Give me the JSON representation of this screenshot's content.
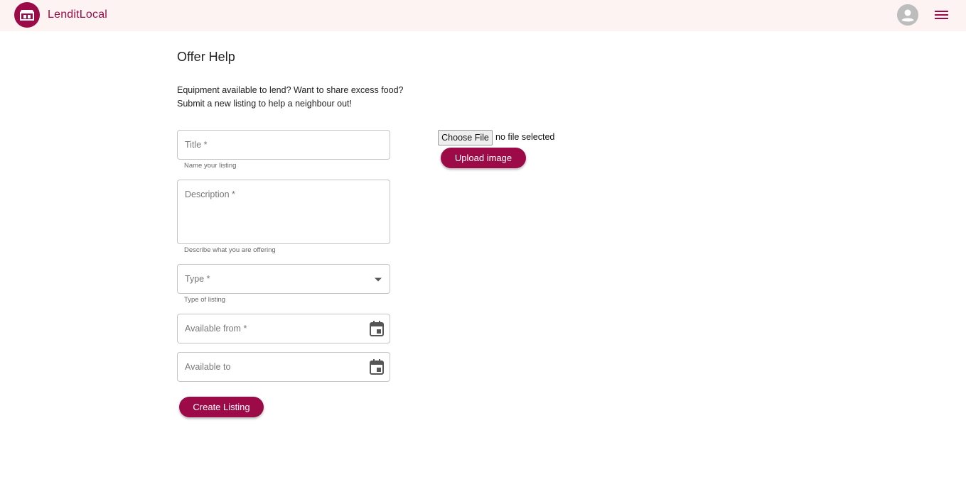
{
  "header": {
    "brand": "LenditLocal",
    "logo_icon": "shop-icon",
    "avatar_icon": "account-circle-icon",
    "menu_icon": "hamburger-menu-icon",
    "accent_color": "#9c0a47",
    "background_color": "#fdf3f3"
  },
  "page": {
    "title": "Offer Help",
    "intro_line1": "Equipment available to lend? Want to share excess food?",
    "intro_line2": "Submit a new listing to help a neighbour out!"
  },
  "form": {
    "title": {
      "label": "Title *",
      "helper": "Name your listing"
    },
    "description": {
      "label": "Description *",
      "helper": "Describe what you are offering"
    },
    "type": {
      "label": "Type *",
      "helper": "Type of listing",
      "icon": "dropdown-arrow-icon"
    },
    "available_from": {
      "label": "Available from *",
      "icon": "calendar-icon"
    },
    "available_to": {
      "label": "Available to",
      "icon": "calendar-icon"
    },
    "submit_label": "Create Listing"
  },
  "upload": {
    "choose_file_label": "Choose File",
    "file_status": "no file selected",
    "upload_label": "Upload image"
  }
}
